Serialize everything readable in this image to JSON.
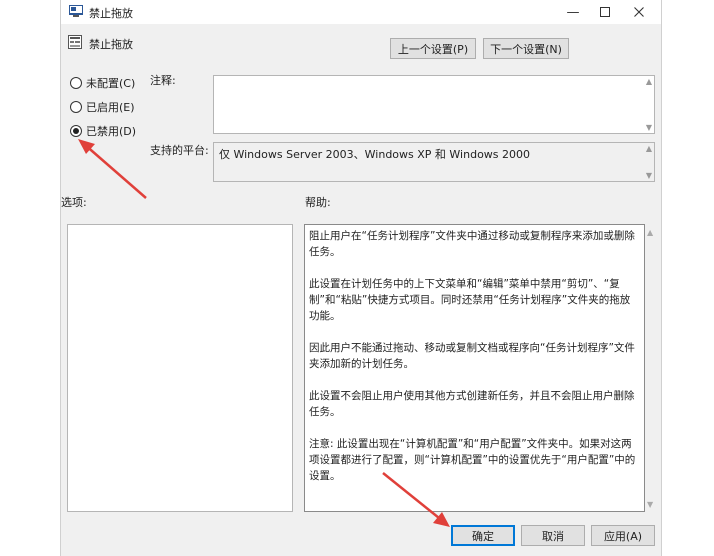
{
  "window": {
    "title": "禁止拖放"
  },
  "policy": {
    "name": "禁止拖放"
  },
  "nav": {
    "prev_label": "上一个设置(P)",
    "next_label": "下一个设置(N)"
  },
  "options": [
    {
      "label": "未配置(C)",
      "checked": false
    },
    {
      "label": "已启用(E)",
      "checked": false
    },
    {
      "label": "已禁用(D)",
      "checked": true
    }
  ],
  "comment": {
    "label": "注释:",
    "value": ""
  },
  "platform": {
    "label": "支持的平台:",
    "value": "仅 Windows Server 2003、Windows XP 和 Windows 2000"
  },
  "options_section": {
    "label": "选项:"
  },
  "help_section": {
    "label": "帮助:",
    "paragraphs": [
      "阻止用户在“任务计划程序”文件夹中通过移动或复制程序来添加或删除任务。",
      "此设置在计划任务中的上下文菜单和“编辑”菜单中禁用“剪切”、“复制”和“粘贴”快捷方式项目。同时还禁用“任务计划程序”文件夹的拖放功能。",
      "因此用户不能通过拖动、移动或复制文档或程序向“任务计划程序”文件夹添加新的计划任务。",
      "此设置不会阻止用户使用其他方式创建新任务，并且不会阻止用户删除任务。",
      "注意: 此设置出现在“计算机配置”和“用户配置”文件夹中。如果对这两项设置都进行了配置，则“计算机配置”中的设置优先于“用户配置”中的设置。"
    ]
  },
  "footer": {
    "ok_label": "确定",
    "cancel_label": "取消",
    "apply_label": "应用(A)"
  },
  "colors": {
    "annotation_arrow": "#e0403a",
    "accent_border": "#0078d7"
  }
}
